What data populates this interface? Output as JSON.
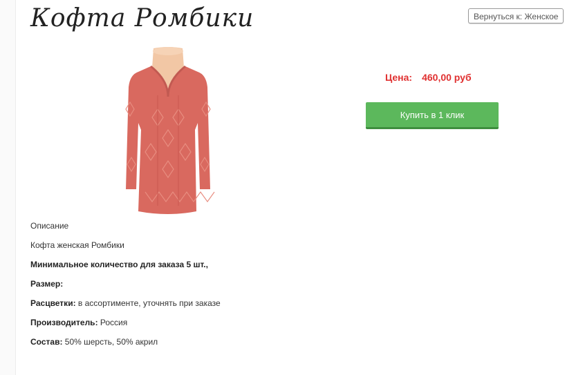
{
  "product": {
    "title": "Кофта Ромбики",
    "back_button_label": "Вернуться к: Женское",
    "image_alt": "Кофта Ромбики",
    "price_label": "Цена:",
    "price_value": "460,00 руб",
    "buy_button_label": "Купить в 1 клик"
  },
  "description": {
    "heading": "Описание",
    "name": "Кофта женская Ромбики",
    "min_order": "Минимальное количество для заказа 5 шт.,",
    "size_label": "Размер:",
    "size_value": "",
    "colors_label": "Расцветки:",
    "colors_value": " в ассортименте, уточнять при заказе",
    "manufacturer_label": "Производитель:",
    "manufacturer_value": " Россия",
    "composition_label": "Состав:",
    "composition_value": " 50% шерсть, 50% акрил"
  },
  "colors": {
    "price": "#e03030",
    "buy_button": "#5cb85c",
    "sweater": "#d9695f"
  }
}
